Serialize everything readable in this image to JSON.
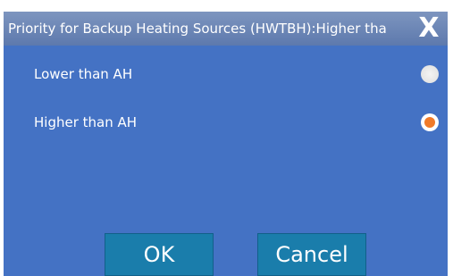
{
  "dialog": {
    "title": "Priority for Backup Heating Sources (HWTBH):Higher tha",
    "close_label": "X",
    "options": [
      {
        "label": "Lower than AH",
        "selected": false
      },
      {
        "label": "Higher than AH",
        "selected": true
      }
    ],
    "ok_label": "OK",
    "cancel_label": "Cancel"
  },
  "colors": {
    "titlebar": "#6a85b6",
    "body": "#4472c4",
    "button": "#1a7dab",
    "radio_selected": "#f07a2a"
  }
}
